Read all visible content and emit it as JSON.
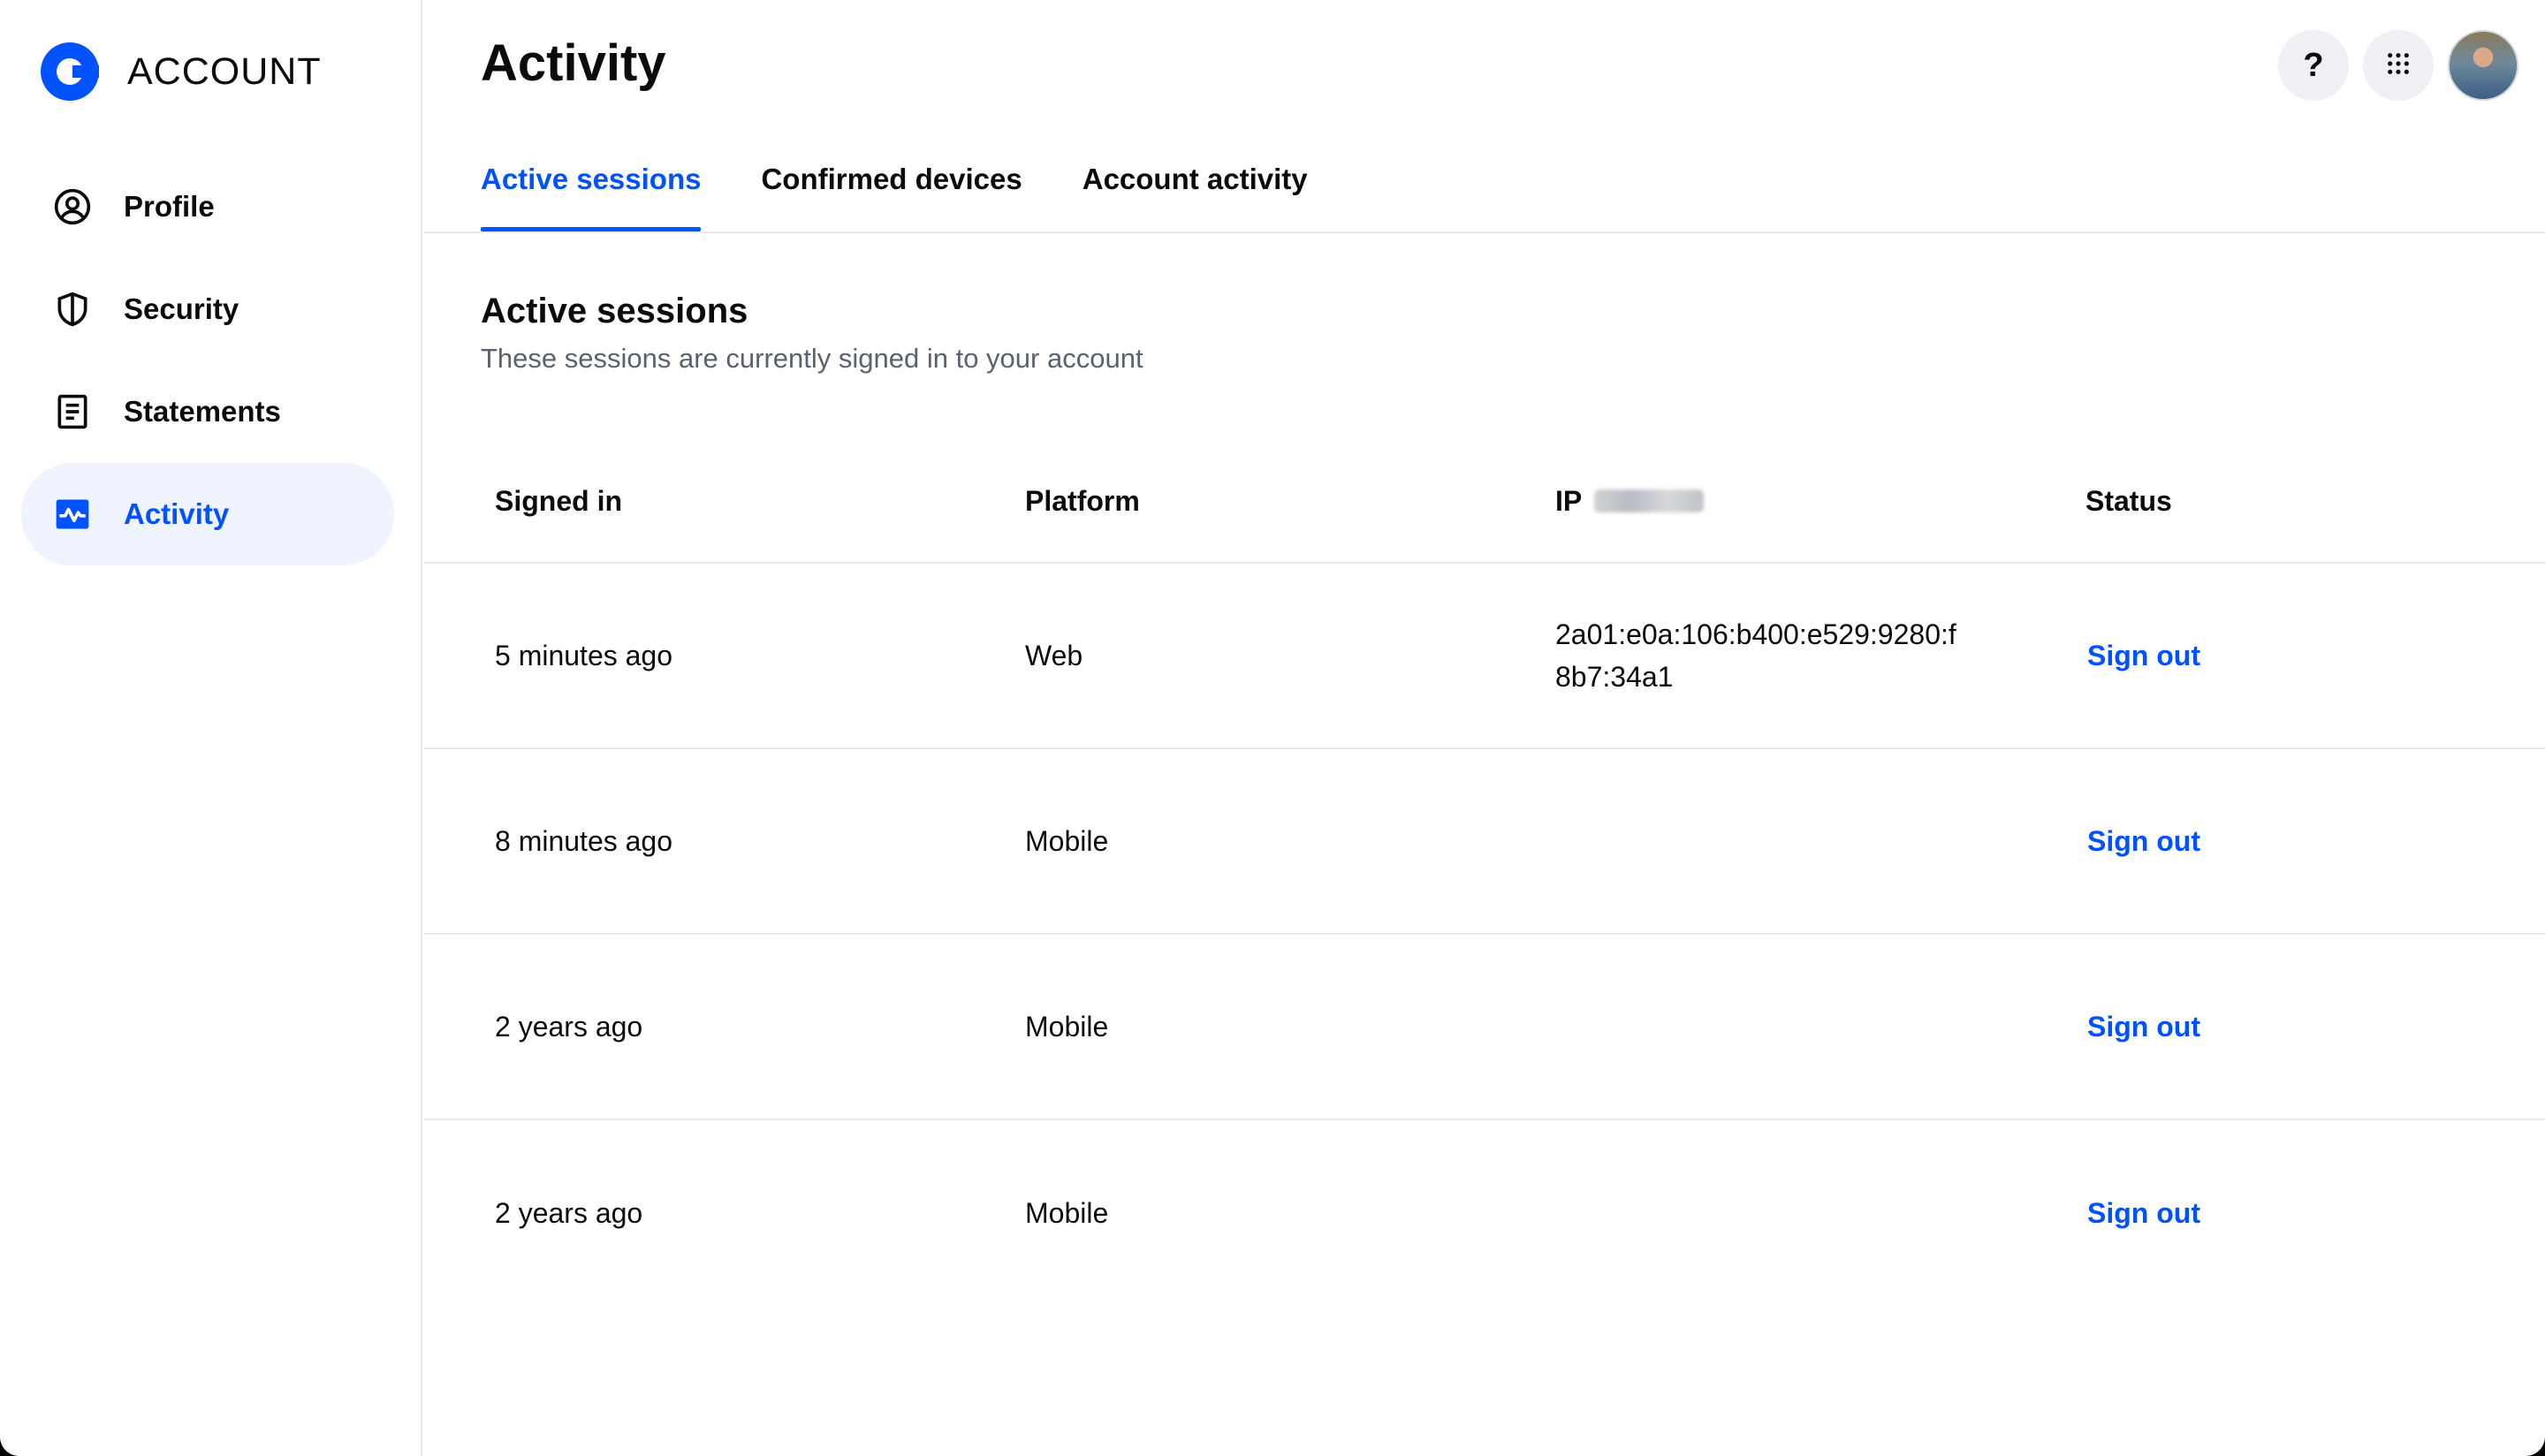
{
  "brand": {
    "name": "ACCOUNT",
    "logo": "coinbase-logo"
  },
  "sidebar": {
    "items": [
      {
        "label": "Profile",
        "icon": "user-circle-icon"
      },
      {
        "label": "Security",
        "icon": "shield-icon"
      },
      {
        "label": "Statements",
        "icon": "document-icon"
      },
      {
        "label": "Activity",
        "icon": "activity-icon",
        "active": true
      }
    ]
  },
  "header": {
    "title": "Activity",
    "help_label": "?",
    "icons": [
      "help-icon",
      "apps-grid-icon",
      "avatar"
    ]
  },
  "tabs": [
    {
      "label": "Active sessions",
      "active": true
    },
    {
      "label": "Confirmed devices"
    },
    {
      "label": "Account activity"
    }
  ],
  "section": {
    "title": "Active sessions",
    "subtitle": "These sessions are currently signed in to your account"
  },
  "table": {
    "headers": {
      "signed_in": "Signed in",
      "platform": "Platform",
      "ip": "IP",
      "status": "Status"
    },
    "rows": [
      {
        "signed_in": "5 minutes ago",
        "platform": "Web",
        "ip": "2a01:e0a:106:b400:e529:9280:f8b7:34a1",
        "status": "Sign out"
      },
      {
        "signed_in": "8 minutes ago",
        "platform": "Mobile",
        "ip": "",
        "status": "Sign out"
      },
      {
        "signed_in": "2 years ago",
        "platform": "Mobile",
        "ip": "",
        "status": "Sign out"
      },
      {
        "signed_in": "2 years ago",
        "platform": "Mobile",
        "ip": "",
        "status": "Sign out"
      }
    ]
  },
  "colors": {
    "accent": "#0052ff",
    "text": "#0a0b0d",
    "muted": "#5b616e",
    "active_bg": "#eef3fe",
    "divider": "#e5e7eb"
  }
}
